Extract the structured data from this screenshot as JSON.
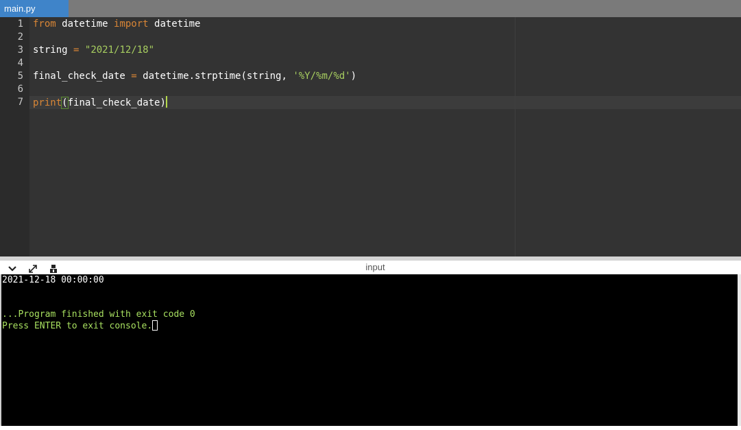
{
  "tab": {
    "label": "main.py"
  },
  "editor": {
    "line_numbers": [
      "1",
      "2",
      "3",
      "4",
      "5",
      "6",
      "7"
    ],
    "lines": {
      "l1": {
        "kw1": "from",
        "t1": " datetime ",
        "kw2": "import",
        "t2": " datetime"
      },
      "l3": {
        "t1": "string ",
        "op": "=",
        "t2": " ",
        "str": "\"2021/12/18\""
      },
      "l5": {
        "t1": "final_check_date ",
        "op": "=",
        "t2": " datetime.strptime(string, ",
        "str": "'%Y/%m/%d'",
        "t3": ")"
      },
      "l7": {
        "kw": "print",
        "open": "(",
        "t1": "final_check_date",
        "close": ")"
      }
    }
  },
  "console": {
    "title": "input",
    "icons": [
      "chevron-down-icon",
      "expand-icon",
      "settings-icon"
    ],
    "output_line": "2021-12-18 00:00:00",
    "finished_line": "...Program finished with exit code 0",
    "press_line": "Press ENTER to exit console."
  },
  "colors": {
    "keyword": "#d98636",
    "string": "#a8cf60",
    "console_text": "#a8e060",
    "tab_active": "#3f84c9"
  }
}
